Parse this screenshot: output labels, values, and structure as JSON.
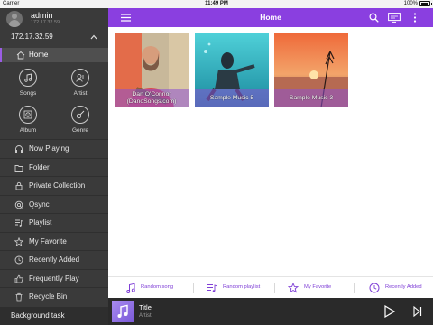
{
  "status_bar": {
    "carrier": "Carrier",
    "time": "11:49 PM",
    "battery": "100%"
  },
  "sidebar": {
    "user": {
      "name": "admin",
      "ip": "172.17.32.59"
    },
    "nas": {
      "ip": "172.17.32.59"
    },
    "home": "Home",
    "grid": [
      {
        "label": "Songs",
        "icon": "note-icon"
      },
      {
        "label": "Artist",
        "icon": "artist-icon"
      },
      {
        "label": "Album",
        "icon": "album-icon"
      },
      {
        "label": "Genre",
        "icon": "guitar-icon"
      }
    ],
    "items": [
      {
        "label": "Now Playing",
        "icon": "headphones-icon"
      },
      {
        "label": "Folder",
        "icon": "folder-icon"
      },
      {
        "label": "Private Collection",
        "icon": "lock-icon"
      },
      {
        "label": "Qsync",
        "icon": "qsync-icon"
      },
      {
        "label": "Playlist",
        "icon": "playlist-icon"
      },
      {
        "label": "My Favorite",
        "icon": "star-icon"
      },
      {
        "label": "Recently Added",
        "icon": "clock-icon"
      },
      {
        "label": "Frequently Play",
        "icon": "thumbs-up-icon"
      },
      {
        "label": "Recycle Bin",
        "icon": "trash-icon"
      }
    ],
    "background_task": "Background task"
  },
  "topbar": {
    "title": "Home"
  },
  "albums": [
    {
      "caption_line1": "Dan O'Connor",
      "caption_line2": "(DanoSongs.com)"
    },
    {
      "caption_line1": "Sample Music 5",
      "caption_line2": ""
    },
    {
      "caption_line1": "Sample Music 3",
      "caption_line2": ""
    }
  ],
  "quick_actions": [
    {
      "label": "Random song",
      "icon": "note-icon"
    },
    {
      "label": "Random playlist",
      "icon": "playlist-icon"
    },
    {
      "label": "My Favorite",
      "icon": "star-icon"
    },
    {
      "label": "Recently Added",
      "icon": "clock-icon"
    }
  ],
  "player": {
    "title": "Title",
    "artist": "Artist"
  },
  "colors": {
    "accent": "#8a3fe0",
    "sidebar": "#3a3a3a",
    "player": "#2a2a2a"
  }
}
